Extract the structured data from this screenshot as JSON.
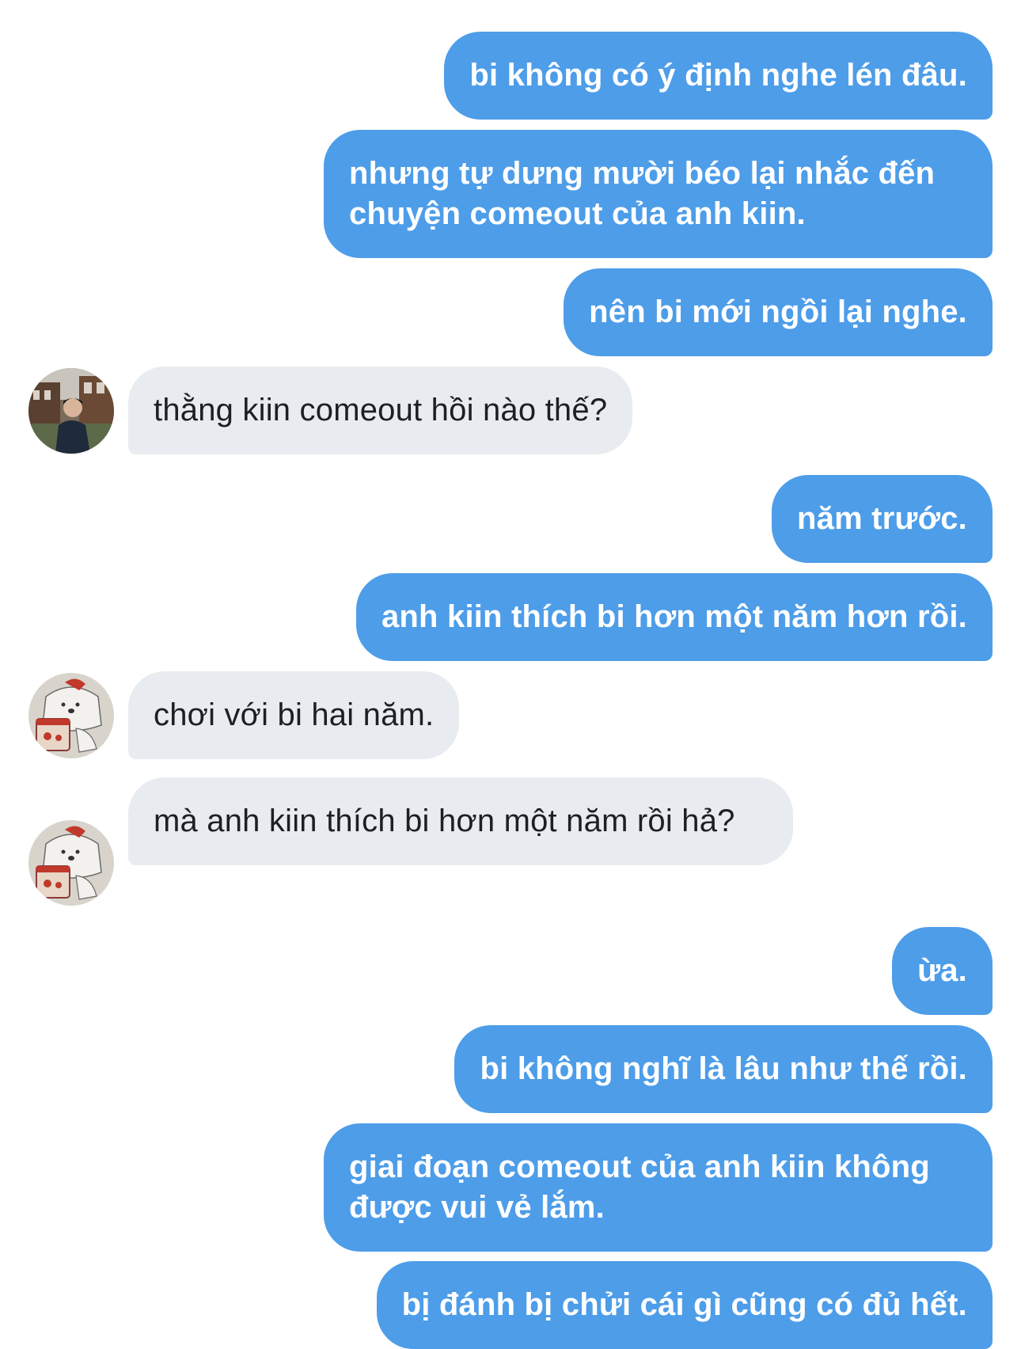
{
  "messages": [
    {
      "id": "m1",
      "side": "out",
      "text": "bi không có ý định nghe lén đâu."
    },
    {
      "id": "m2",
      "side": "out",
      "text": "nhưng tự dưng mười béo lại nhắc đến chuyện comeout của anh kiin."
    },
    {
      "id": "m3",
      "side": "out",
      "text": "nên bi mới ngồi lại nghe."
    },
    {
      "id": "m4",
      "side": "in",
      "avatar": "photo-avatar",
      "text": "thằng kiin comeout hồi nào thế?"
    },
    {
      "id": "m5",
      "side": "out",
      "text": "năm trước."
    },
    {
      "id": "m6",
      "side": "out",
      "text": "anh kiin thích bi hơn một năm hơn rồi."
    },
    {
      "id": "m7",
      "side": "in",
      "avatar": "bear-avatar",
      "text": "chơi với bi hai năm."
    },
    {
      "id": "m8",
      "side": "in",
      "avatar": "bear-avatar",
      "text": "mà anh kiin thích bi hơn một năm rồi hả?"
    },
    {
      "id": "m9",
      "side": "out",
      "text": "ừa."
    },
    {
      "id": "m10",
      "side": "out",
      "text": "bi không nghĩ là lâu như thế rồi."
    },
    {
      "id": "m11",
      "side": "out",
      "text": "giai đoạn comeout của anh kiin không được vui vẻ lắm."
    },
    {
      "id": "m12",
      "side": "out",
      "text": "bị đánh bị chửi cái gì cũng có đủ hết."
    }
  ],
  "colors": {
    "outgoing_bubble": "#4d9de9",
    "incoming_bubble": "#e8ebef",
    "outgoing_text": "#ffffff",
    "incoming_text": "#1c1f23"
  }
}
